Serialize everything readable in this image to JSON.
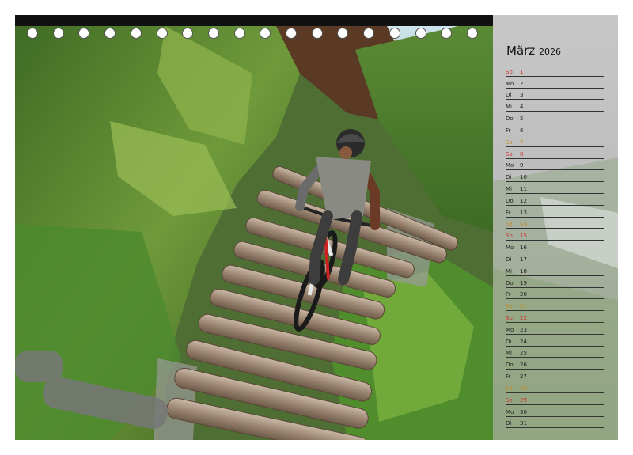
{
  "calendar": {
    "month": "März",
    "year": "2026",
    "days": [
      {
        "wd": "So",
        "d": "1",
        "type": "sun"
      },
      {
        "wd": "Mo",
        "d": "2",
        "type": ""
      },
      {
        "wd": "Di",
        "d": "3",
        "type": ""
      },
      {
        "wd": "Mi",
        "d": "4",
        "type": ""
      },
      {
        "wd": "Do",
        "d": "5",
        "type": ""
      },
      {
        "wd": "Fr",
        "d": "6",
        "type": ""
      },
      {
        "wd": "Sa",
        "d": "7",
        "type": "sat"
      },
      {
        "wd": "So",
        "d": "8",
        "type": "sun"
      },
      {
        "wd": "Mo",
        "d": "9",
        "type": ""
      },
      {
        "wd": "Di",
        "d": "10",
        "type": ""
      },
      {
        "wd": "Mi",
        "d": "11",
        "type": ""
      },
      {
        "wd": "Do",
        "d": "12",
        "type": ""
      },
      {
        "wd": "Fr",
        "d": "13",
        "type": ""
      },
      {
        "wd": "Sa",
        "d": "14",
        "type": "sat"
      },
      {
        "wd": "So",
        "d": "15",
        "type": "sun"
      },
      {
        "wd": "Mo",
        "d": "16",
        "type": ""
      },
      {
        "wd": "Di",
        "d": "17",
        "type": ""
      },
      {
        "wd": "Mi",
        "d": "18",
        "type": ""
      },
      {
        "wd": "Do",
        "d": "19",
        "type": ""
      },
      {
        "wd": "Fr",
        "d": "20",
        "type": ""
      },
      {
        "wd": "Sa",
        "d": "21",
        "type": "sat"
      },
      {
        "wd": "So",
        "d": "22",
        "type": "sun"
      },
      {
        "wd": "Mo",
        "d": "23",
        "type": ""
      },
      {
        "wd": "Di",
        "d": "24",
        "type": ""
      },
      {
        "wd": "Mi",
        "d": "25",
        "type": ""
      },
      {
        "wd": "Do",
        "d": "26",
        "type": ""
      },
      {
        "wd": "Fr",
        "d": "27",
        "type": ""
      },
      {
        "wd": "Sa",
        "d": "28",
        "type": "sat"
      },
      {
        "wd": "So",
        "d": "29",
        "type": "sun"
      },
      {
        "wd": "Mo",
        "d": "30",
        "type": ""
      },
      {
        "wd": "Di",
        "d": "31",
        "type": ""
      }
    ]
  },
  "colors": {
    "sunday": "#d0312d",
    "saturday": "#c58a2a",
    "binding": "#111111"
  },
  "photo": {
    "subject": "mountain-biker-on-log-steps"
  }
}
